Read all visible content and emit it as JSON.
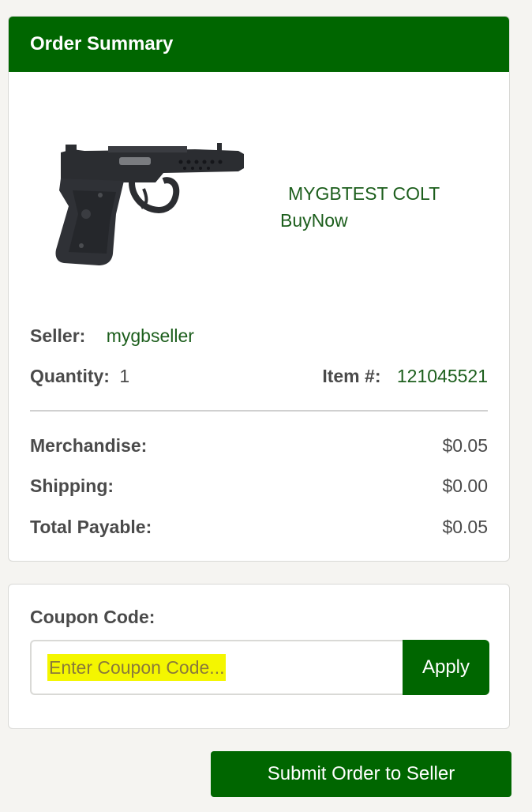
{
  "order_summary": {
    "title": "Order Summary",
    "product": {
      "image_icon": "pistol-image",
      "title_line1": "MYGBTEST COLT",
      "title_line2": "BuyNow"
    },
    "seller_label": "Seller:",
    "seller_value": "mygbseller",
    "quantity_label": "Quantity:",
    "quantity_value": "1",
    "item_label": "Item #:",
    "item_value": "121045521",
    "merchandise_label": "Merchandise:",
    "merchandise_value": "$0.05",
    "shipping_label": "Shipping:",
    "shipping_value": "$0.00",
    "total_label": "Total Payable:",
    "total_value": "$0.05"
  },
  "coupon": {
    "label": "Coupon Code:",
    "placeholder": "Enter Coupon Code...",
    "apply_label": "Apply"
  },
  "submit_label": "Submit Order to Seller",
  "colors": {
    "brand_green": "#006600",
    "link_green": "#1c5e1c",
    "highlight": "#f4f600"
  }
}
